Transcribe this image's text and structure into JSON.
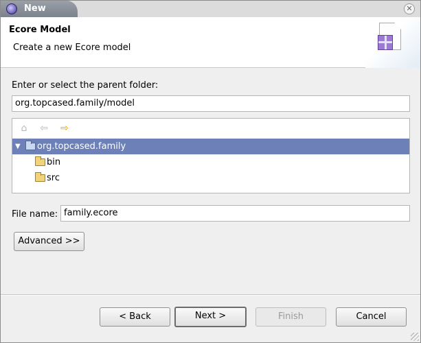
{
  "window": {
    "title": "New",
    "close_glyph": "✕"
  },
  "banner": {
    "title": "Ecore Model",
    "subtitle": "Create a new Ecore model"
  },
  "parent_folder": {
    "label": "Enter or select the parent folder:",
    "value": "org.topcased.family/model"
  },
  "tree": {
    "toolbar": {
      "home_icon": "⌂",
      "back_icon": "⇦",
      "forward_icon": "⇨"
    },
    "items": [
      {
        "label": "org.topcased.family",
        "expanded_glyph": "▼"
      },
      {
        "label": "bin"
      },
      {
        "label": "src"
      }
    ]
  },
  "file_name": {
    "label": "File name:",
    "value": "family.ecore"
  },
  "buttons": {
    "advanced": "Advanced >>",
    "back": "< Back",
    "next": "Next >",
    "finish": "Finish",
    "cancel": "Cancel"
  },
  "colors": {
    "selection": "#6d81b8",
    "window_bg": "#efefef"
  }
}
